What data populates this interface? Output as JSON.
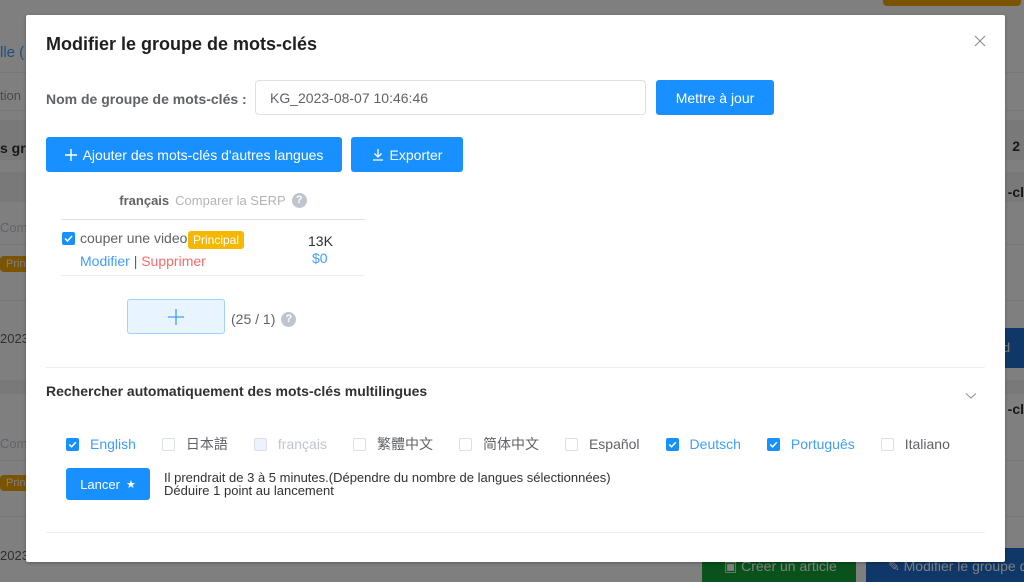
{
  "background": {
    "left_link": "lle (",
    "left_col": "tion",
    "left_bold": "s gr",
    "left_com": "Com",
    "left_prin": "Prin",
    "left_date": "2023",
    "right_num": "2",
    "right_bold": "-cl",
    "right_btn": "e d",
    "create_article": "Créer un article",
    "edit_group": "Modifier le groupe d"
  },
  "modal": {
    "title": "Modifier le groupe de mots-clés",
    "name_label": "Nom de groupe de mots-clés :",
    "name_value": "KG_2023-08-07 10:46:46",
    "update_label": "Mettre à jour",
    "add_languages_label": "Ajouter des mots-clés d'autres langues",
    "export_label": "Exporter",
    "keyword_table": {
      "language": "français",
      "compare_serp": "Comparer la SERP",
      "rows": [
        {
          "keyword": "couper une video",
          "checked": true,
          "badge": "Principal",
          "edit_label": "Modifier",
          "separator": "|",
          "delete_label": "Supprimer",
          "volume": "13K",
          "cpc": "$0"
        }
      ]
    },
    "keyword_count": "(25 / 1)",
    "auto_search": {
      "title": "Rechercher automatiquement des mots-clés multilingues",
      "languages": [
        {
          "label": "English",
          "state": "checked"
        },
        {
          "label": "日本語",
          "state": "unchecked"
        },
        {
          "label": "français",
          "state": "disabled"
        },
        {
          "label": "繁體中文",
          "state": "unchecked"
        },
        {
          "label": "简体中文",
          "state": "unchecked"
        },
        {
          "label": "Español",
          "state": "unchecked"
        },
        {
          "label": "Deutsch",
          "state": "checked"
        },
        {
          "label": "Português",
          "state": "checked"
        },
        {
          "label": "Italiano",
          "state": "unchecked"
        }
      ],
      "launch_label": "Lancer",
      "info_line1": "Il prendrait de 3 à 5 minutes.(Dépendre du nombre de langues sélectionnées)",
      "info_line2": "Déduire 1 point au lancement"
    }
  },
  "colors": {
    "primary": "#1890ff",
    "badge": "#f5b800",
    "danger": "#f56c6c",
    "link": "#409eff"
  }
}
